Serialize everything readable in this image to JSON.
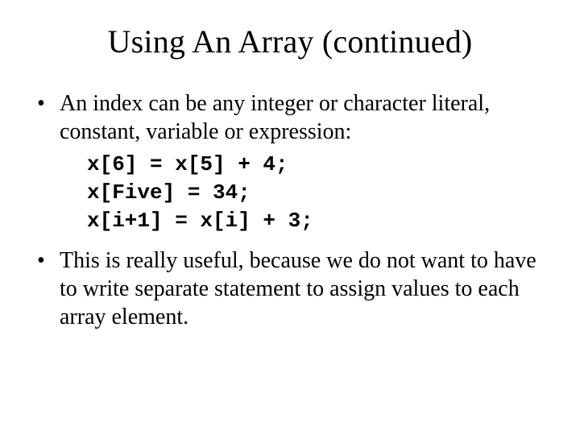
{
  "slide": {
    "title": "Using An Array (continued)",
    "bullets": [
      "An index can be any integer or character literal, constant, variable or expression:",
      "This is really useful, because we do not want to have to write separate statement to assign values to each array element."
    ],
    "code": [
      "x[6] = x[5] + 4;",
      "x[Five] = 34;",
      "x[i+1] = x[i] + 3;"
    ]
  }
}
